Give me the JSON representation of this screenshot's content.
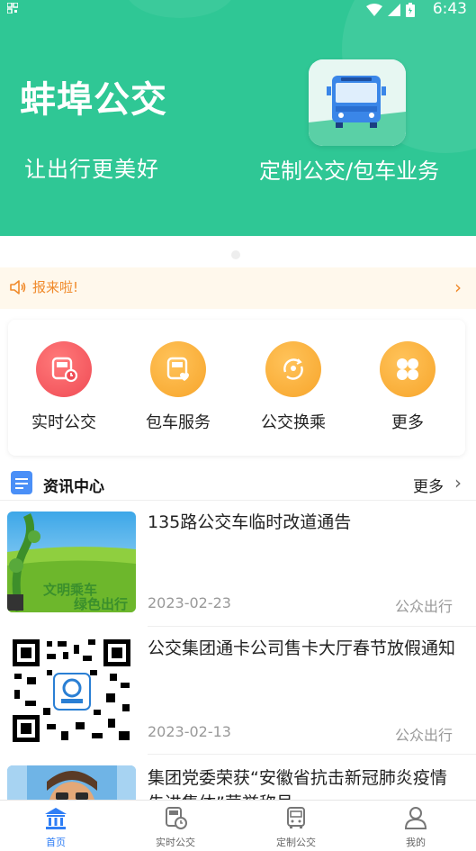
{
  "status_bar": {
    "time": "6:43"
  },
  "banner": {
    "title": "蚌埠公交",
    "slogan": "让出行更美好",
    "custom_label": "定制公交/包车业务"
  },
  "notice": {
    "text": "报来啦!"
  },
  "quick_actions": [
    {
      "label": "实时公交",
      "icon": "realtime-bus-icon"
    },
    {
      "label": "包车服务",
      "icon": "charter-bus-icon"
    },
    {
      "label": "公交换乘",
      "icon": "transfer-icon"
    },
    {
      "label": "更多",
      "icon": "more-grid-icon"
    }
  ],
  "news": {
    "header": "资讯中心",
    "more": "更多",
    "items": [
      {
        "title": "135路公交车临时改道通告",
        "date": "2023-02-23",
        "source": "公众出行"
      },
      {
        "title": "公交集团通卡公司售卡大厅春节放假通知",
        "date": "2023-02-13",
        "source": "公众出行"
      },
      {
        "title": "集团党委荣获“安徽省抗击新冠肺炎疫情先进集体”荣誉称号",
        "date": "",
        "source": ""
      }
    ],
    "thumb1_text": [
      "文明乘车",
      "绿色出行"
    ]
  },
  "bottom_nav": [
    {
      "label": "首页",
      "active": true
    },
    {
      "label": "实时公交",
      "active": false
    },
    {
      "label": "定制公交",
      "active": false
    },
    {
      "label": "我的",
      "active": false
    }
  ],
  "colors": {
    "brand_green": "#2fc795",
    "accent_blue": "#2f7ef5",
    "notice_orange": "#f08a2b"
  }
}
